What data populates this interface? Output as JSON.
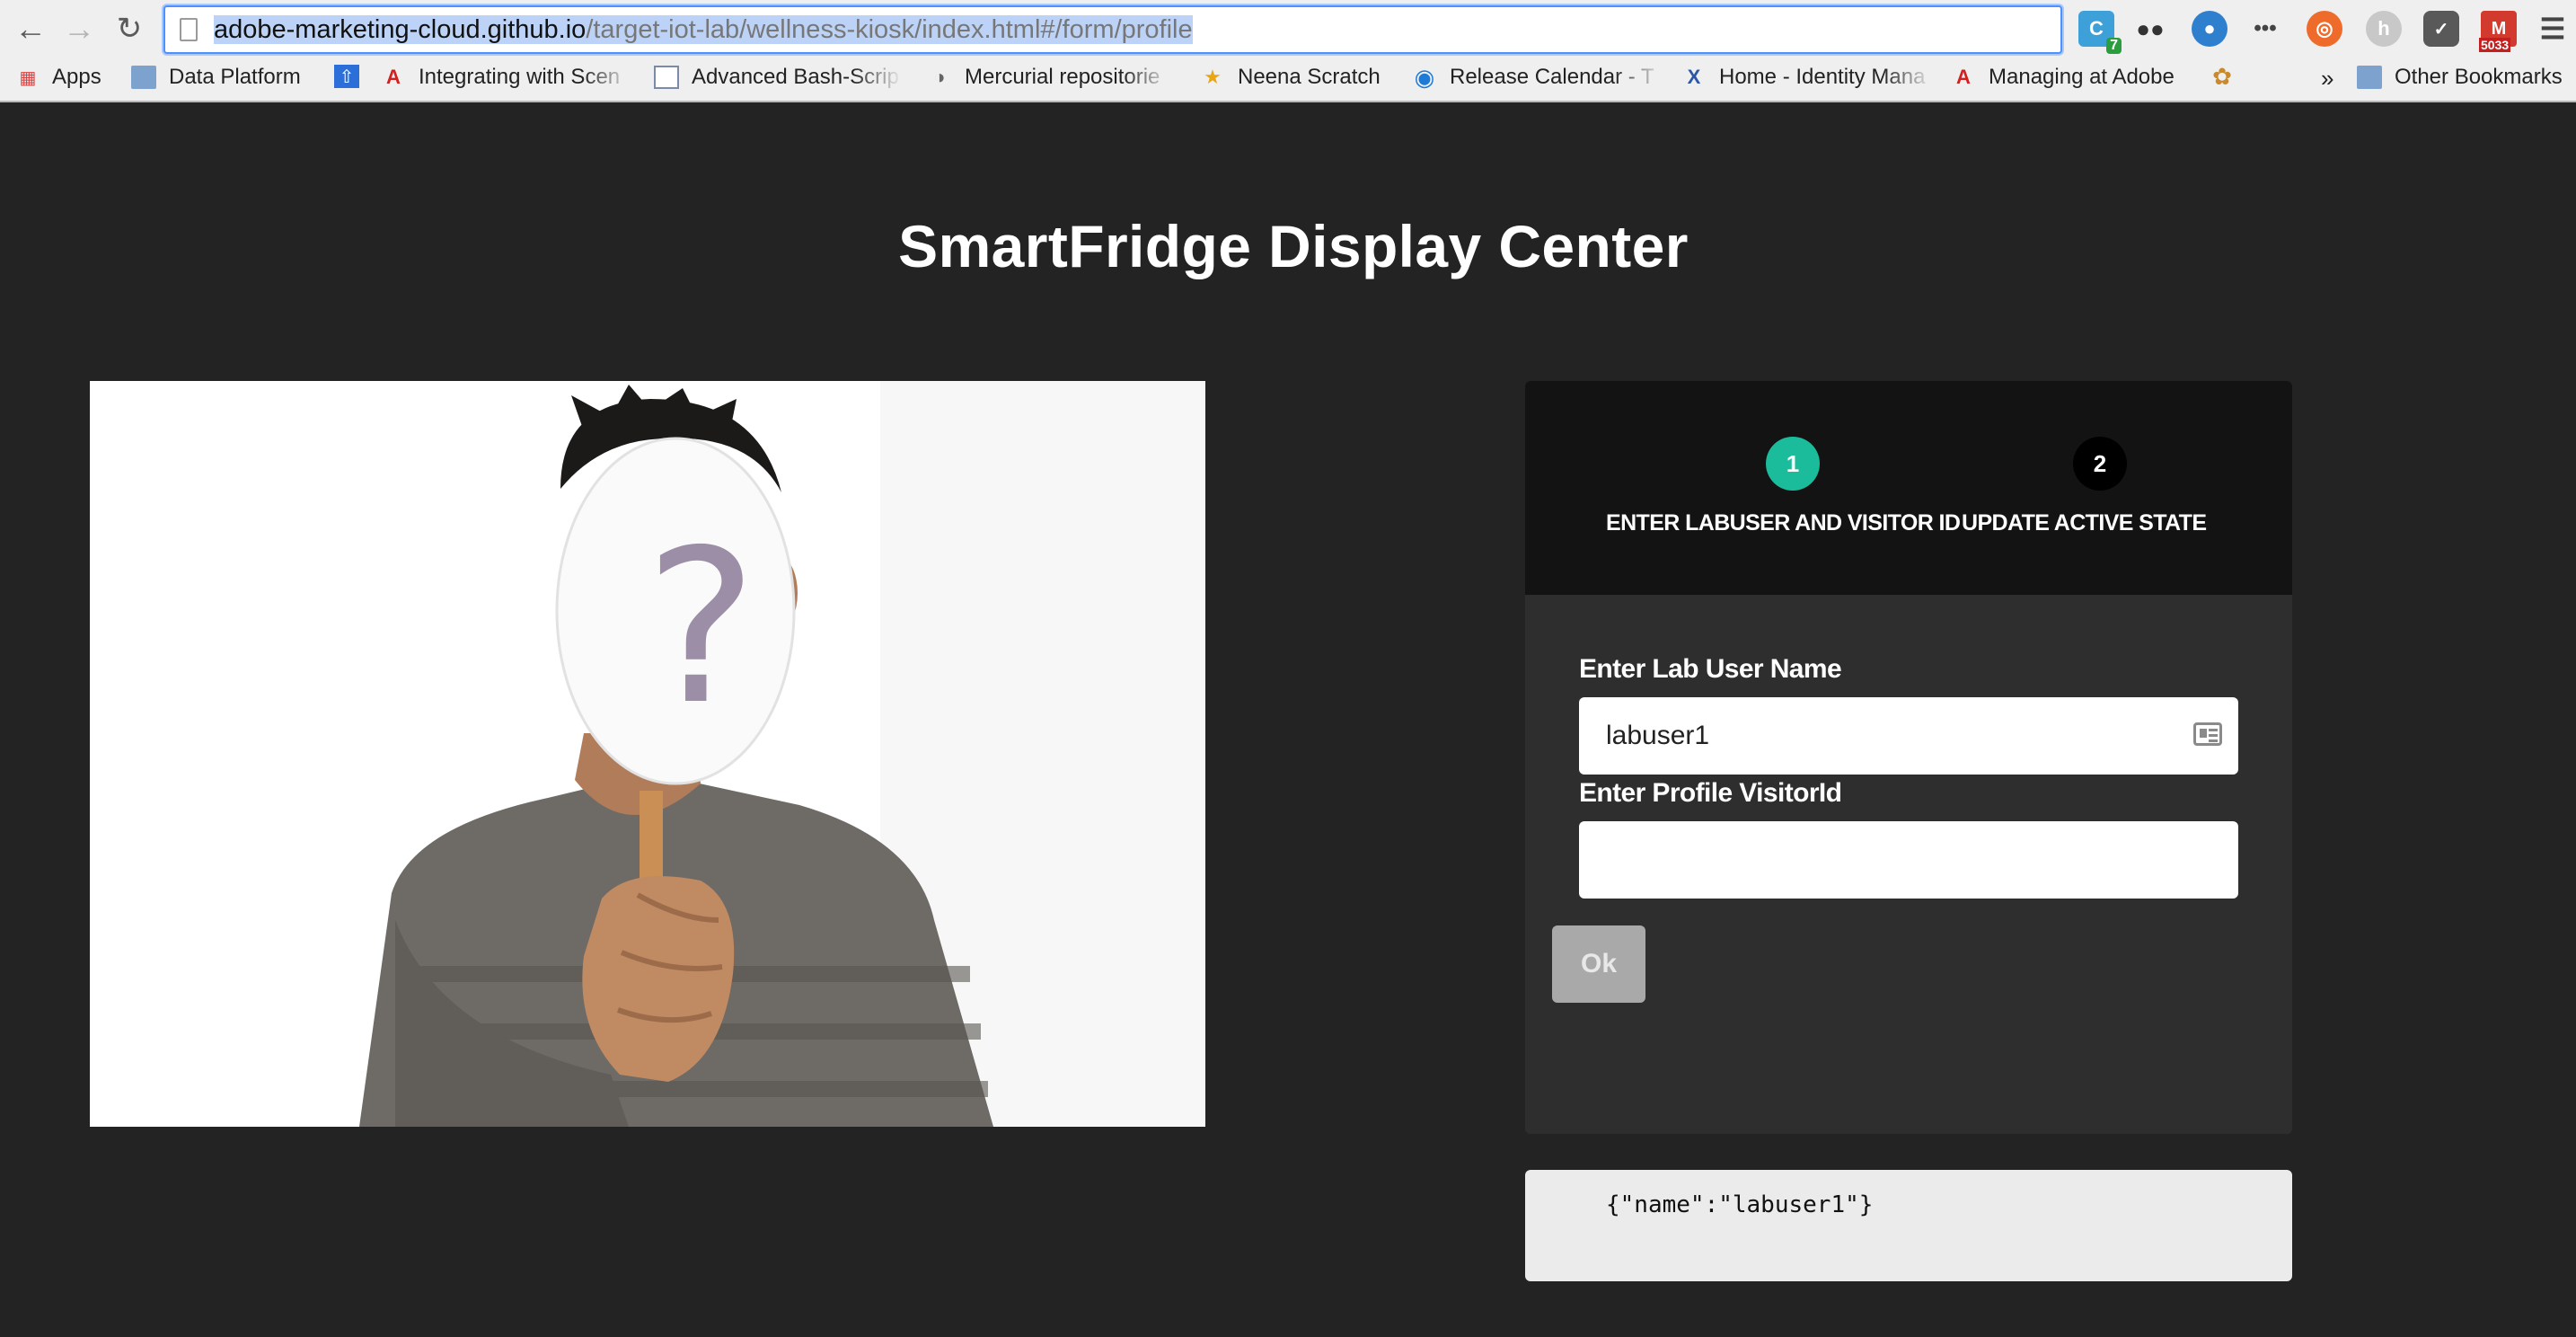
{
  "browser": {
    "url_host": "adobe-marketing-cloud.github.io",
    "url_path": "/target-iot-lab/wellness-kiosk/index.html#/form/profile",
    "ext_badge_count": "7",
    "gmail_badge": "5033",
    "bookmarks": [
      {
        "label": "Apps"
      },
      {
        "label": "Data Platform"
      },
      {
        "label": ""
      },
      {
        "label": "Integrating with Scen"
      },
      {
        "label": "Advanced Bash-Scrip"
      },
      {
        "label": "Mercurial repositorie"
      },
      {
        "label": "Neena Scratch"
      },
      {
        "label": "Release Calendar - T"
      },
      {
        "label": "Home - Identity Mana"
      },
      {
        "label": "Managing at Adobe"
      }
    ],
    "overflow_chevron": "»",
    "other_bookmarks": "Other Bookmarks"
  },
  "page": {
    "title": "SmartFridge Display Center"
  },
  "wizard": {
    "steps": [
      {
        "number": "1",
        "label": "ENTER LABUSER AND VISITOR ID",
        "active": true
      },
      {
        "number": "2",
        "label": "UPDATE ACTIVE STATE",
        "active": false
      }
    ],
    "username_label": "Enter Lab User Name",
    "username_value": "labuser1",
    "visitor_label": "Enter Profile VisitorId",
    "visitor_value": "",
    "ok_label": "Ok"
  },
  "output": {
    "json_text": "{\"name\":\"labuser1\"}"
  },
  "colors": {
    "step_active": "#1bbc9b",
    "step_inactive": "#000000",
    "page_bg": "#232323",
    "panel_bg": "#2e2e2e"
  }
}
